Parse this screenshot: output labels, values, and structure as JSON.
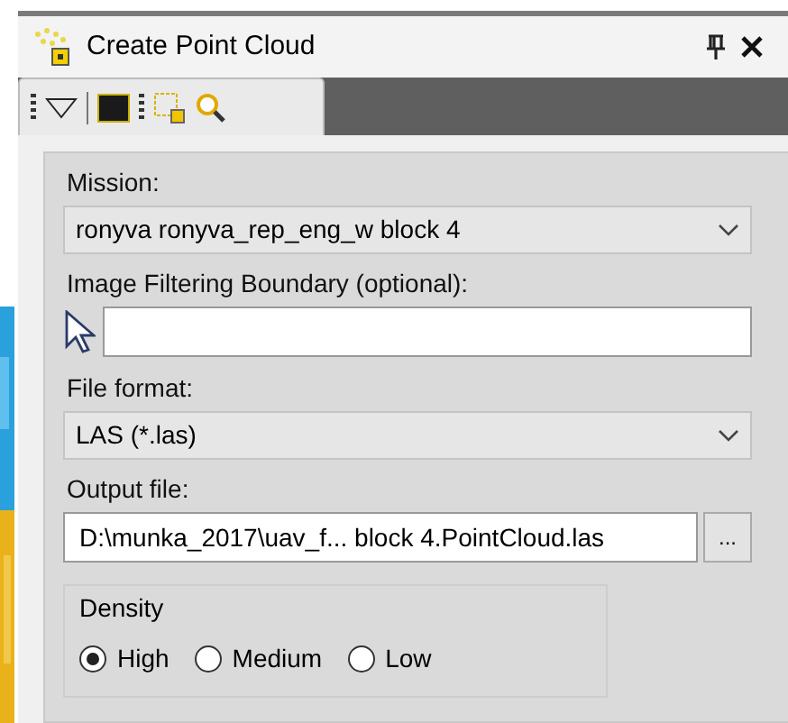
{
  "panel": {
    "title": "Create Point Cloud"
  },
  "fields": [
    {
      "kind": "select",
      "label": "Mission:",
      "value": "ronyva ronyva_rep_eng_w block 4"
    },
    {
      "kind": "boundary",
      "label": "Image Filtering Boundary (optional):"
    },
    {
      "kind": "select",
      "label": "File format:",
      "value": "LAS (*.las)"
    },
    {
      "kind": "file",
      "label": "Output file:",
      "value": "D:\\munka_2017\\uav_f... block 4.PointCloud.las",
      "button": "..."
    }
  ],
  "density": {
    "label": "Density",
    "options": [
      {
        "label": "High",
        "selected": true
      },
      {
        "label": "Medium",
        "selected": false
      },
      {
        "label": "Low",
        "selected": false
      }
    ]
  }
}
